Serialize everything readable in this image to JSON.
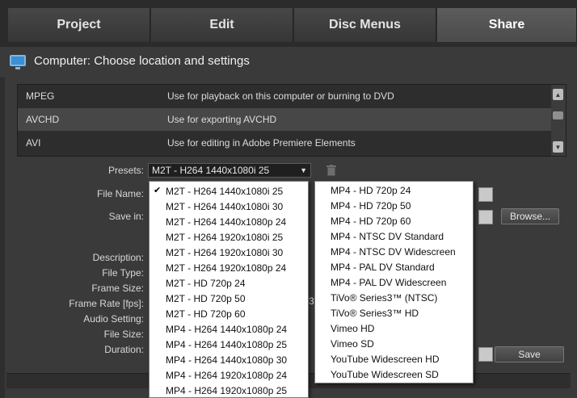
{
  "tabs": [
    {
      "label": "Project"
    },
    {
      "label": "Edit"
    },
    {
      "label": "Disc Menus"
    },
    {
      "label": "Share"
    }
  ],
  "active_tab": "Share",
  "heading": "Computer: Choose location and settings",
  "formats": [
    {
      "name": "MPEG",
      "description": "Use for playback on this computer or burning to DVD"
    },
    {
      "name": "AVCHD",
      "description": "Use for exporting AVCHD"
    },
    {
      "name": "AVI",
      "description": "Use for editing in Adobe Premiere Elements"
    }
  ],
  "selected_format": "AVCHD",
  "labels": {
    "presets": "Presets:",
    "file_name": "File Name:",
    "save_in": "Save in:",
    "description": "Description:",
    "file_type": "File Type:",
    "frame_size": "Frame Size:",
    "frame_rate": "Frame Rate [fps]:",
    "audio_setting": "Audio Setting:",
    "file_size": "File Size:",
    "duration": "Duration:"
  },
  "presets_value": "M2T - H264 1440x1080i 25",
  "buttons": {
    "browse": "Browse...",
    "save": "Save"
  },
  "preset_menu_left": [
    {
      "label": "M2T - H264 1440x1080i 25",
      "checked": true
    },
    {
      "label": "M2T - H264 1440x1080i 30"
    },
    {
      "label": "M2T - H264 1440x1080p 24"
    },
    {
      "label": "M2T - H264 1920x1080i 25"
    },
    {
      "label": "M2T - H264 1920x1080i 30"
    },
    {
      "label": "M2T - H264 1920x1080p 24"
    },
    {
      "label": "M2T - HD 720p 24"
    },
    {
      "label": "M2T - HD 720p 50"
    },
    {
      "label": "M2T - HD 720p 60"
    },
    {
      "label": "MP4 - H264 1440x1080p 24"
    },
    {
      "label": "MP4 - H264 1440x1080p 25"
    },
    {
      "label": "MP4 - H264 1440x1080p 30"
    },
    {
      "label": "MP4 - H264 1920x1080p 24"
    },
    {
      "label": "MP4 - H264 1920x1080p 25"
    }
  ],
  "preset_menu_right": [
    {
      "label": "MP4 - HD 720p 24"
    },
    {
      "label": "MP4 - HD 720p 50"
    },
    {
      "label": "MP4 - HD 720p 60"
    },
    {
      "label": "MP4 - NTSC DV Standard"
    },
    {
      "label": "MP4 - NTSC DV Widescreen"
    },
    {
      "label": "MP4 - PAL DV Standard"
    },
    {
      "label": "MP4 - PAL DV Widescreen"
    },
    {
      "label": "TiVo® Series3™ (NTSC)"
    },
    {
      "label": "TiVo® Series3™ HD"
    },
    {
      "label": "Vimeo HD"
    },
    {
      "label": "Vimeo SD"
    },
    {
      "label": "YouTube Widescreen HD"
    },
    {
      "label": "YouTube Widescreen SD"
    }
  ],
  "partial_text": "3",
  "icons": {
    "computer": "monitor-icon",
    "presets_caret": "chevron-down-icon",
    "delete_preset": "trash-icon",
    "check": "checkmark-icon"
  },
  "colors": {
    "accent": "#3b8fd6",
    "panel": "#3a3a3a",
    "selected_row": "#474747"
  }
}
